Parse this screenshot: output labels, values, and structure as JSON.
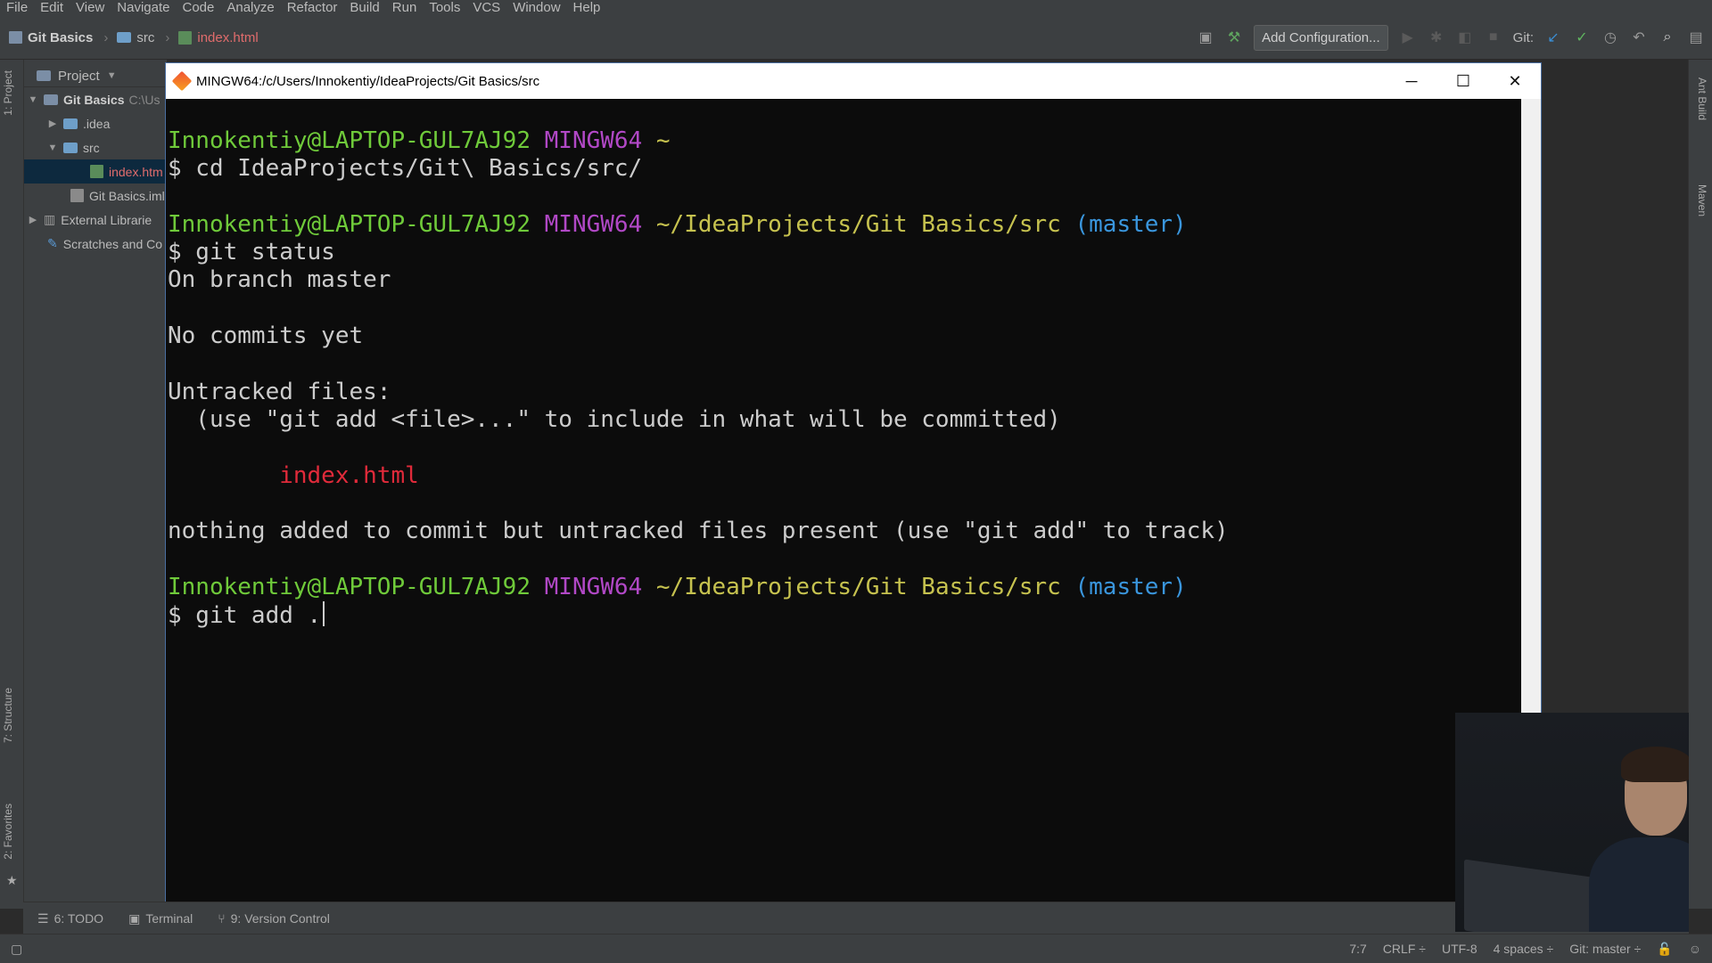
{
  "menu": [
    "File",
    "Edit",
    "View",
    "Navigate",
    "Code",
    "Analyze",
    "Refactor",
    "Build",
    "Run",
    "Tools",
    "VCS",
    "Window",
    "Help"
  ],
  "breadcrumb": {
    "project": "Git Basics",
    "folder": "src",
    "file": "index.html"
  },
  "toolbar": {
    "add_config": "Add Configuration...",
    "git_label": "Git:"
  },
  "left_strip": {
    "project_tab": "1: Project",
    "structure_tab": "7: Structure",
    "favorites_tab": "2: Favorites"
  },
  "right_strip": {
    "ant_tab": "Ant Build",
    "maven_tab": "Maven"
  },
  "project_panel": {
    "title": "Project",
    "tree": [
      {
        "label": "Git Basics",
        "suffix": "C:\\Us"
      },
      {
        "label": ".idea"
      },
      {
        "label": "src"
      },
      {
        "label": "index.htm"
      },
      {
        "label": "Git Basics.iml"
      },
      {
        "label": "External Librarie"
      },
      {
        "label": "Scratches and Co"
      }
    ]
  },
  "terminal": {
    "title": "MINGW64:/c/Users/Innokentiy/IdeaProjects/Git Basics/src",
    "user_host": "Innokentiy@LAPTOP-GUL7AJ92",
    "shell": "MINGW64",
    "home": "~",
    "path": "~/IdeaProjects/Git Basics/src",
    "branch": "(master)",
    "cmd1": "$ cd IdeaProjects/Git\\ Basics/src/",
    "cmd2": "$ git status",
    "out1": "On branch master",
    "out2": "No commits yet",
    "out3": "Untracked files:",
    "out4": "  (use \"git add <file>...\" to include in what will be committed)",
    "out5": "        index.html",
    "out6": "nothing added to commit but untracked files present (use \"git add\" to track)",
    "cmd3": "$ git add ."
  },
  "bottom_tabs": {
    "todo": "6: TODO",
    "terminal": "Terminal",
    "vc": "9: Version Control"
  },
  "status": {
    "pos": "7:7",
    "eol": "CRLF ÷",
    "enc": "UTF-8",
    "indent": "4 spaces ÷",
    "git": "Git: master ÷"
  }
}
